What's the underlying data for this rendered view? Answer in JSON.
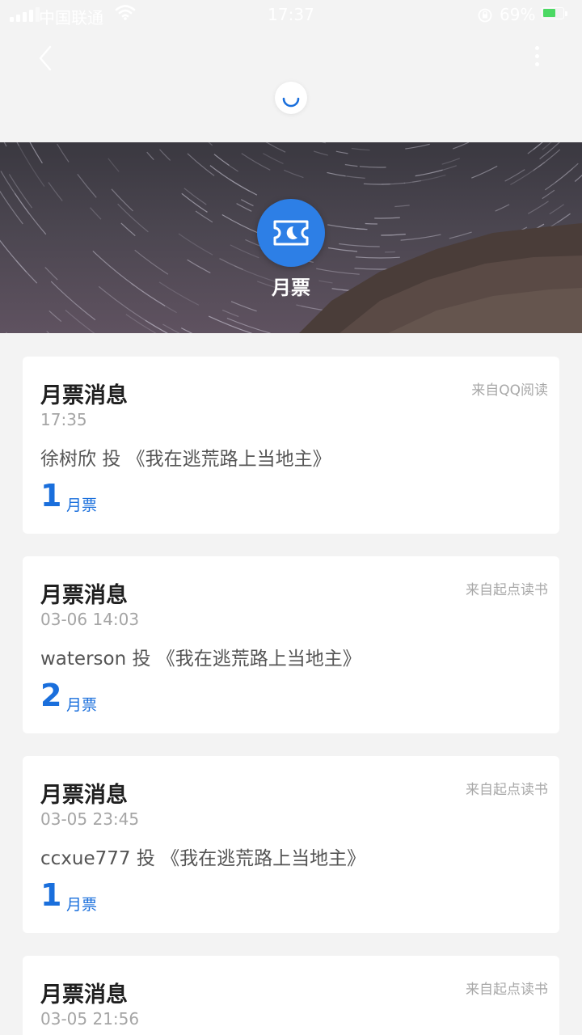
{
  "status_bar": {
    "carrier": "中国联通",
    "time": "17:37",
    "battery_percent": "69%"
  },
  "nav": {
    "back_icon": "chevron-left-icon",
    "more_icon": "more-vertical-icon"
  },
  "banner": {
    "icon": "ticket-icon",
    "title": "月票"
  },
  "messages": [
    {
      "title": "月票消息",
      "source": "来自QQ阅读",
      "time": "17:35",
      "voter": "徐树欣",
      "action": "投",
      "book": "《我在逃荒路上当地主》",
      "count": "1",
      "unit": "月票"
    },
    {
      "title": "月票消息",
      "source": "来自起点读书",
      "time": "03-06 14:03",
      "voter": "waterson",
      "action": "投",
      "book": "《我在逃荒路上当地主》",
      "count": "2",
      "unit": "月票"
    },
    {
      "title": "月票消息",
      "source": "来自起点读书",
      "time": "03-05 23:45",
      "voter": "ccxue777",
      "action": "投",
      "book": "《我在逃荒路上当地主》",
      "count": "1",
      "unit": "月票"
    },
    {
      "title": "月票消息",
      "source": "来自起点读书",
      "time": "03-05 21:56"
    }
  ],
  "colors": {
    "accent": "#1a6fdc",
    "badge": "#2d7fe6",
    "page_background": "#f3f3f3"
  }
}
